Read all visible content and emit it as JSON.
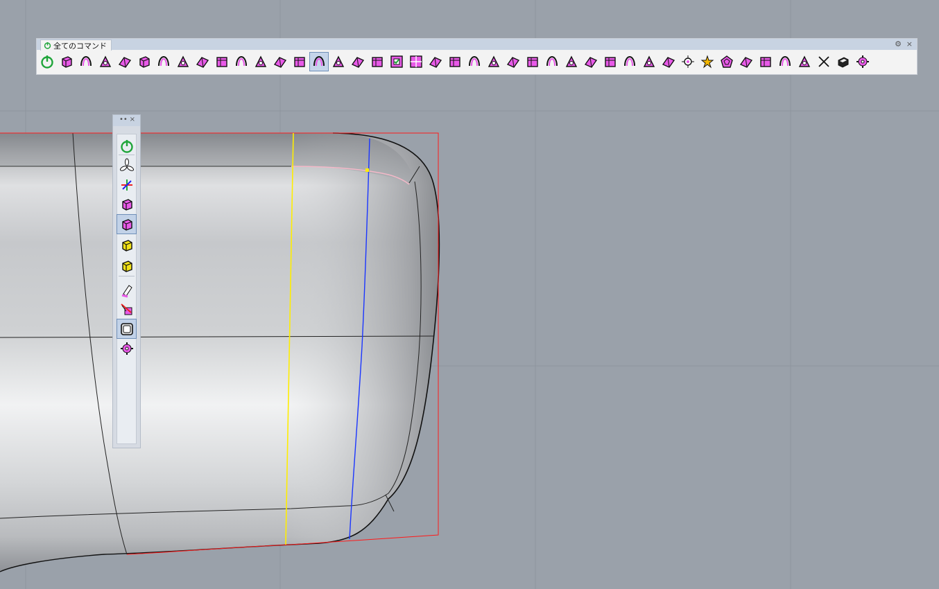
{
  "toolbar": {
    "tab_label": "全てのコマンド",
    "gear_glyph": "⚙",
    "close_glyph": "×",
    "icons": [
      "power-icon",
      "box-icon",
      "sphere-icon",
      "blend-icon",
      "transform-icon",
      "cube-icon",
      "arrow-icon",
      "hand-icon",
      "rotate-icon",
      "surface-icon",
      "arch-icon",
      "sweep-icon",
      "fold-icon",
      "extrude-icon",
      "gumball-icon",
      "cage-icon",
      "stretch-icon",
      "bridge-icon",
      "checkbox-face-icon",
      "grid-icon",
      "flip-icon",
      "delete-icon",
      "crease-icon",
      "crease-edit-icon",
      "loop-icon",
      "slide-icon",
      "insert-icon",
      "points-icon",
      "curve-icon",
      "palm-icon",
      "weld-icon",
      "branch-icon",
      "pattern-icon",
      "center-icon",
      "star-icon",
      "pentagon-icon",
      "stair-icon",
      "strip-icon",
      "plane-icon",
      "patch-icon",
      "pinch-icon",
      "shell-icon",
      "gear-icon"
    ],
    "active_index": 14
  },
  "floating_toolbar": {
    "grip_glyph": "••",
    "close_glyph": "×",
    "icons": [
      "power-icon",
      "tristar-icon",
      "axes-icon",
      "cube-vertex-icon",
      "cube-edge-icon",
      "cube-face-icon",
      "cube-object-icon",
      "pen-icon",
      "erase-icon",
      "keycap-icon",
      "gear-icon"
    ],
    "active_indices": [
      4,
      9
    ]
  },
  "colors": {
    "background": "#9aa1aa",
    "accent_magenta": "#e85ae8",
    "power_green": "#1fa53a",
    "select_blue": "#6f8fb8"
  }
}
